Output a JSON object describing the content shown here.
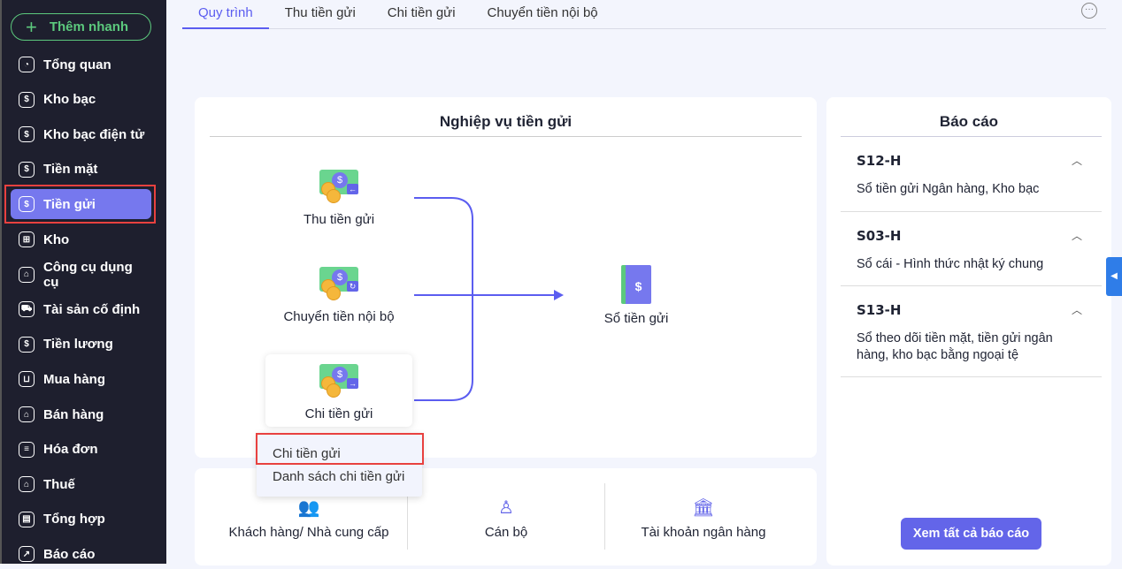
{
  "sidebar": {
    "quick_add": "Thêm nhanh",
    "items": [
      {
        "label": "Tổng quan",
        "icon": "pie-chart-icon"
      },
      {
        "label": "Kho bạc",
        "icon": "treasury-icon"
      },
      {
        "label": "Kho bạc điện tử",
        "icon": "e-treasury-icon"
      },
      {
        "label": "Tiền mặt",
        "icon": "cash-icon"
      },
      {
        "label": "Tiền gửi",
        "icon": "deposit-icon"
      },
      {
        "label": "Kho",
        "icon": "warehouse-icon"
      },
      {
        "label": "Công cụ dụng cụ",
        "icon": "tools-icon"
      },
      {
        "label": "Tài sản cố định",
        "icon": "truck-icon"
      },
      {
        "label": "Tiền lương",
        "icon": "salary-icon"
      },
      {
        "label": "Mua hàng",
        "icon": "cart-icon"
      },
      {
        "label": "Bán hàng",
        "icon": "store-icon"
      },
      {
        "label": "Hóa đơn",
        "icon": "invoice-icon"
      },
      {
        "label": "Thuế",
        "icon": "bank-icon"
      },
      {
        "label": "Tổng hợp",
        "icon": "summary-icon"
      },
      {
        "label": "Báo cáo",
        "icon": "report-icon"
      }
    ]
  },
  "tabs": [
    "Quy trình",
    "Thu tiền gửi",
    "Chi tiền gửi",
    "Chuyển tiền nội bộ"
  ],
  "process": {
    "title": "Nghiệp vụ tiền gửi",
    "nodes": [
      "Thu tiền gửi",
      "Chuyển tiền nội bộ",
      "Chi tiền gửi"
    ],
    "target": "Sổ tiền gửi"
  },
  "menu": [
    "Chi tiền gửi",
    "Danh sách chi tiền gửi"
  ],
  "bottom": [
    "Khách hàng/ Nhà cung cấp",
    "Cán bộ",
    "Tài khoản ngân hàng"
  ],
  "reports": {
    "title": "Báo cáo",
    "items": [
      {
        "code": "S12-H",
        "desc": "Sổ tiền gửi Ngân hàng, Kho bạc"
      },
      {
        "code": "S03-H",
        "desc": "Sổ cái - Hình thức nhật ký chung"
      },
      {
        "code": "S13-H",
        "desc": "Sổ theo dõi tiền mặt, tiền gửi ngân hàng, kho bạc bằng ngoại tệ"
      }
    ],
    "view_all": "Xem tất cả báo cáo"
  }
}
